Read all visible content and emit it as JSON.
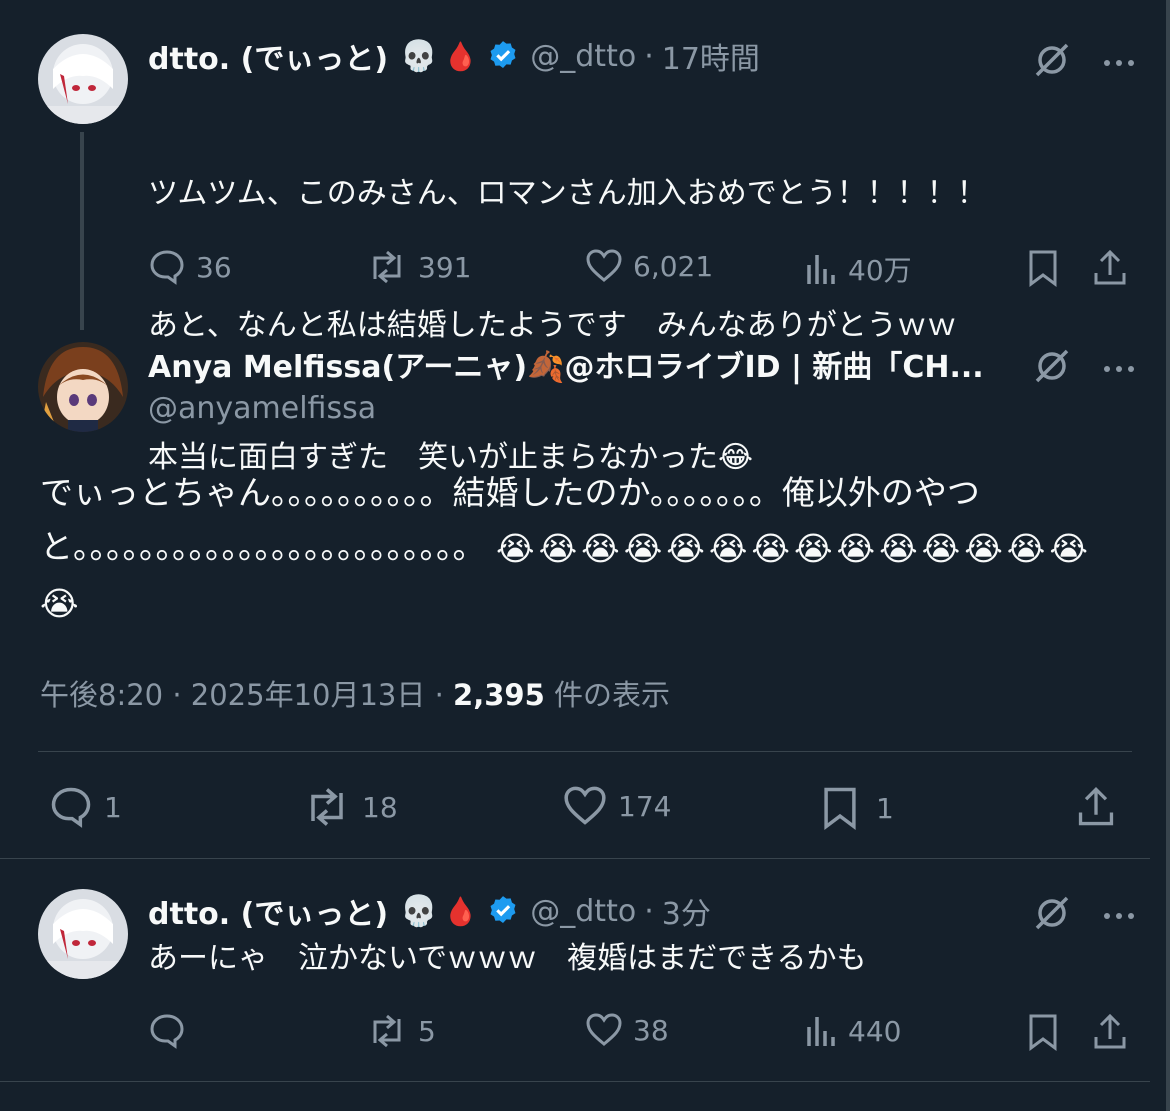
{
  "tweets": [
    {
      "name": "dtto. (でぃっと)",
      "emoji1": "💀",
      "emoji2": "🩸",
      "handle": "@_dtto",
      "dot": "·",
      "time": "17時間",
      "lines": [
        "ツムツム、このみさん、ロマンさん加入おめでとう！！！！！",
        "あと、なんと私は結婚したようです　みんなありがとうｗｗ",
        "本当に面白すぎた　笑いが止まらなかった😂"
      ],
      "replies": "36",
      "reposts": "391",
      "likes": "6,021",
      "views": "40万"
    },
    {
      "name": "Anya Melfissa(アーニャ)🍂@ホロライブID | 新曲「CH...",
      "handle": "@anyamelfissa",
      "text": "でぃっとちゃん。。。。。。。。。。結婚したのか。。。。。。。俺以外のやつと。。。。。。。。。。。。。。。。。。。。。。。。",
      "sob_emoji": "😭",
      "sob_count": 15,
      "meta": {
        "time": "午後8:20",
        "dot1": "·",
        "date": "2025年10月13日",
        "dot2": "·",
        "views": "2,395",
        "views_label": "件の表示"
      },
      "replies": "1",
      "reposts": "18",
      "likes": "174",
      "bookmarks": "1"
    },
    {
      "name": "dtto. (でぃっと)",
      "emoji1": "💀",
      "emoji2": "🩸",
      "handle": "@_dtto",
      "dot": "·",
      "time": "3分",
      "text": "あーにゃ　泣かないでｗｗｗ　複婚はまだできるかも",
      "replies": "",
      "reposts": "5",
      "likes": "38",
      "views": "440"
    }
  ],
  "colors": {
    "background": "#15202b",
    "text": "#f7f9f9",
    "muted": "#8b98a5",
    "divider": "#38444d",
    "verified": "#1d9bf0"
  }
}
